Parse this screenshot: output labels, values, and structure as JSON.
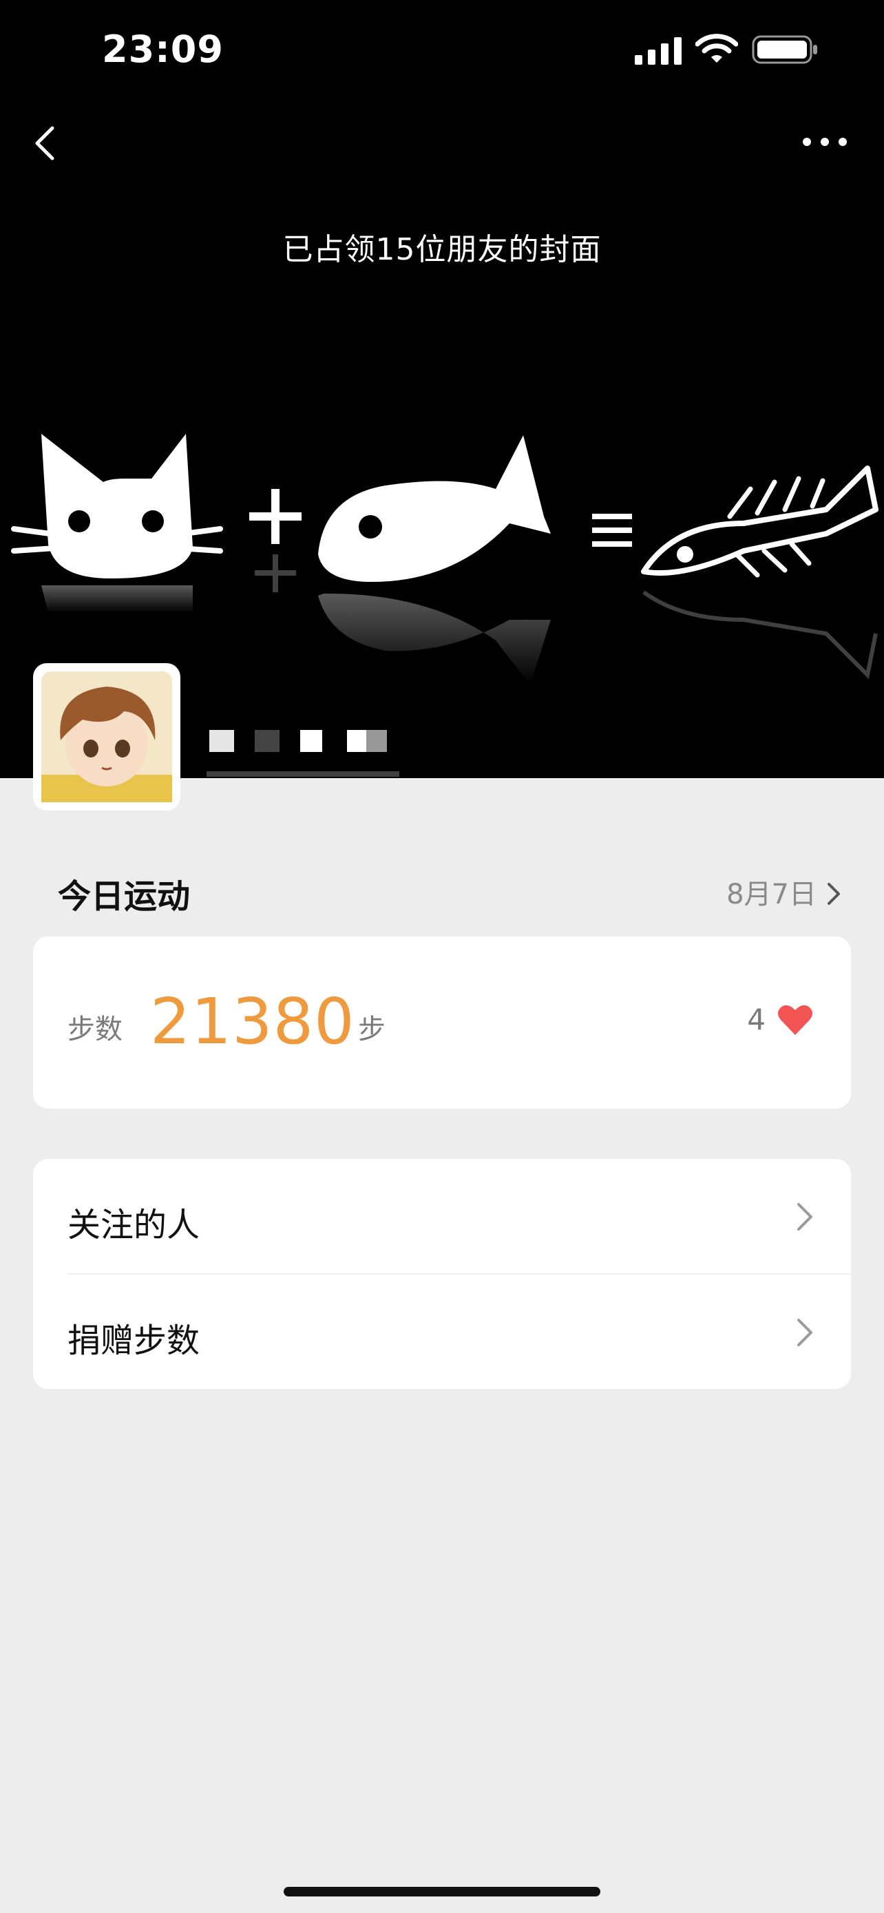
{
  "status_bar": {
    "time": "23:09"
  },
  "cover": {
    "caption": "已占领15位朋友的封面"
  },
  "today": {
    "title": "今日运动",
    "date": "8月7日"
  },
  "steps": {
    "label": "步数",
    "value": "21380",
    "unit": "步",
    "likes": "4"
  },
  "menu": [
    {
      "label": "关注的人"
    },
    {
      "label": "捐赠步数"
    }
  ],
  "colors": {
    "accent": "#f09a3e",
    "heart": "#f25454",
    "background": "#ededed"
  }
}
